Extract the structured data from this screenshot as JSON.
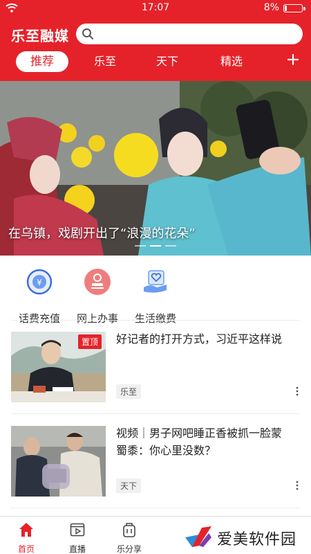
{
  "status_bar": {
    "time": "17:07",
    "battery": "8%"
  },
  "app": {
    "title": "乐至融媒",
    "search_placeholder": ""
  },
  "tabs": [
    {
      "label": "推荐",
      "active": true
    },
    {
      "label": "乐至",
      "active": false
    },
    {
      "label": "天下",
      "active": false
    },
    {
      "label": "精选",
      "active": false
    }
  ],
  "banner": {
    "caption": "在乌镇，戏剧开出了“浪漫的花朵”",
    "slide_count": 3,
    "active_slide": 2
  },
  "services": [
    {
      "label": "话费充值",
      "icon": "phone-bill-icon"
    },
    {
      "label": "网上办事",
      "icon": "stamp-icon"
    },
    {
      "label": "生活缴费",
      "icon": "heart-hand-icon"
    }
  ],
  "news": [
    {
      "title": "好记者的打开方式，习近平这样说",
      "tag": "乐至",
      "badge": "置顶"
    },
    {
      "title": "视频｜男子网吧睡正香被抓一脸蒙　蜀黍：你心里没数？",
      "tag": "天下",
      "badge": ""
    }
  ],
  "bottom_nav": [
    {
      "label": "首页",
      "icon": "home-icon",
      "active": true
    },
    {
      "label": "直播",
      "icon": "live-video-icon",
      "active": false
    },
    {
      "label": "乐分享",
      "icon": "share-bag-icon",
      "active": false
    }
  ],
  "watermark": {
    "text": "爱美软件园"
  },
  "colors": {
    "brand_red": "#e5222a"
  }
}
